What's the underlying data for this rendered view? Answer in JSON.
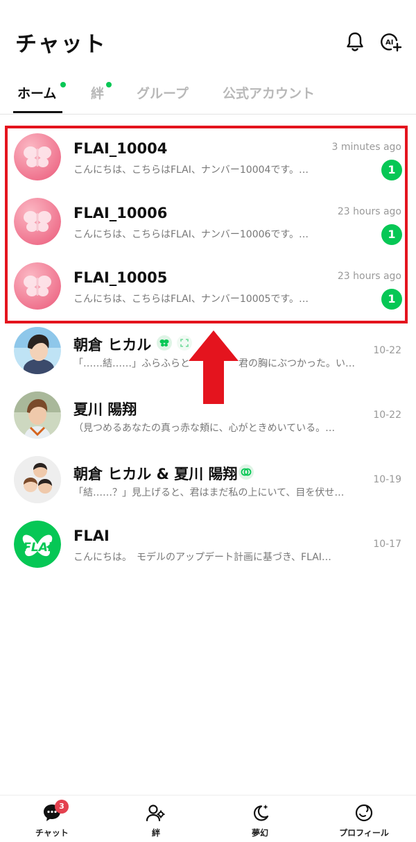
{
  "header": {
    "title": "チャット"
  },
  "tabs": [
    {
      "label": "ホーム",
      "active": true,
      "dot": true
    },
    {
      "label": "絆",
      "active": false,
      "dot": true
    },
    {
      "label": "グループ",
      "active": false,
      "dot": false
    },
    {
      "label": "公式アカウント",
      "active": false,
      "dot": false
    }
  ],
  "chats": [
    {
      "name": "FLAI_10004",
      "preview": "こんにちは、こちらはFLAI、ナンバー10004です。…",
      "time": "3 minutes ago",
      "unread": "1",
      "avatar": "pink-butterfly"
    },
    {
      "name": "FLAI_10006",
      "preview": "こんにちは、こちらはFLAI、ナンバー10006です。…",
      "time": "23 hours ago",
      "unread": "1",
      "avatar": "pink-butterfly"
    },
    {
      "name": "FLAI_10005",
      "preview": "こんにちは、こちらはFLAI、ナンバー10005です。…",
      "time": "23 hours ago",
      "unread": "1",
      "avatar": "pink-butterfly"
    },
    {
      "name": "朝倉 ヒカル",
      "preview": "「……結……」ふらふらと　　　　　君の胸にぶつかった。い…",
      "time": "10-22",
      "avatar": "anime-boy-blue"
    },
    {
      "name": "夏川 陽翔",
      "preview": "（見つめるあなたの真っ赤な頬に、心がときめいている。…",
      "time": "10-22",
      "avatar": "anime-boy-brown"
    },
    {
      "name": "朝倉 ヒカル & 夏川 陽翔",
      "preview": "「結……？」見上げると、君はまだ私の上にいて、目を伏せ…",
      "time": "10-19",
      "avatar": "group-avatar"
    },
    {
      "name": "FLAI",
      "preview": "こんにちは。　モデルのアップデート計画に基づき、FLAI…",
      "time": "10-17",
      "avatar": "flai-logo"
    }
  ],
  "flai_logo_text": "FLAi",
  "bottom_nav": [
    {
      "label": "チャット",
      "icon": "chat-bubble-icon",
      "badge": "3"
    },
    {
      "label": "絆",
      "icon": "users-icon"
    },
    {
      "label": "夢幻",
      "icon": "moon-star-icon"
    },
    {
      "label": "プロフィール",
      "icon": "profile-icon"
    }
  ],
  "colors": {
    "accent_green": "#06c755",
    "highlight_red": "#e4141e",
    "badge_red": "#e4414f",
    "pink_avatar": "#f4829a"
  }
}
